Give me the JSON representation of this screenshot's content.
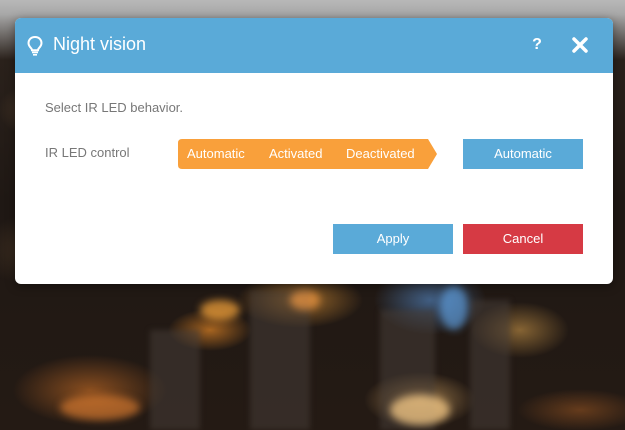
{
  "dialog": {
    "title": "Night vision",
    "title_icon": "lightbulb-icon",
    "help_label": "?",
    "close_icon": "close-icon",
    "description": "Select IR LED behavior.",
    "field_label": "IR LED control",
    "options": [
      "Automatic",
      "Activated",
      "Deactivated"
    ],
    "current_value": "Automatic",
    "apply_label": "Apply",
    "cancel_label": "Cancel"
  },
  "colors": {
    "header": "#5aaad8",
    "segmented": "#f9a03b",
    "apply": "#5aaad8",
    "cancel": "#d63a44",
    "muted_text": "#777777"
  }
}
